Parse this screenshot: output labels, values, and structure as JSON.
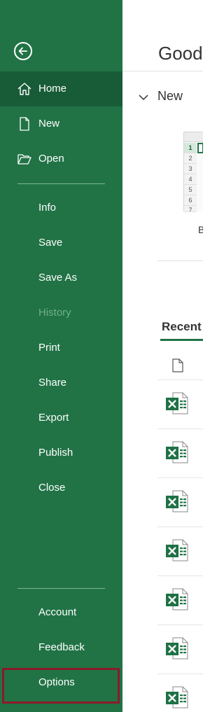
{
  "sidebar": {
    "back_icon": "back-arrow-icon",
    "bg_color": "#217346",
    "active_color": "#185c37",
    "items": [
      {
        "label": "Home",
        "icon": "home-icon",
        "active": true
      },
      {
        "label": "New",
        "icon": "new-document-icon"
      },
      {
        "label": "Open",
        "icon": "open-folder-icon"
      },
      {
        "label": "Info"
      },
      {
        "label": "Save"
      },
      {
        "label": "Save As"
      },
      {
        "label": "History",
        "disabled": true
      },
      {
        "label": "Print"
      },
      {
        "label": "Share"
      },
      {
        "label": "Export"
      },
      {
        "label": "Publish"
      },
      {
        "label": "Close"
      }
    ],
    "bottom_items": [
      {
        "label": "Account"
      },
      {
        "label": "Feedback"
      },
      {
        "label": "Options",
        "highlighted": true,
        "highlight_color": "#8b1a2b"
      }
    ]
  },
  "main": {
    "greeting": "Good",
    "new_section": {
      "title": "New",
      "blank_label": "B"
    },
    "thumbnail_rows": [
      "1",
      "2",
      "3",
      "4",
      "5",
      "6",
      "7"
    ],
    "recent_tab": "Recent",
    "file_icon": "excel-file-icon",
    "recent_file_count": 7
  }
}
